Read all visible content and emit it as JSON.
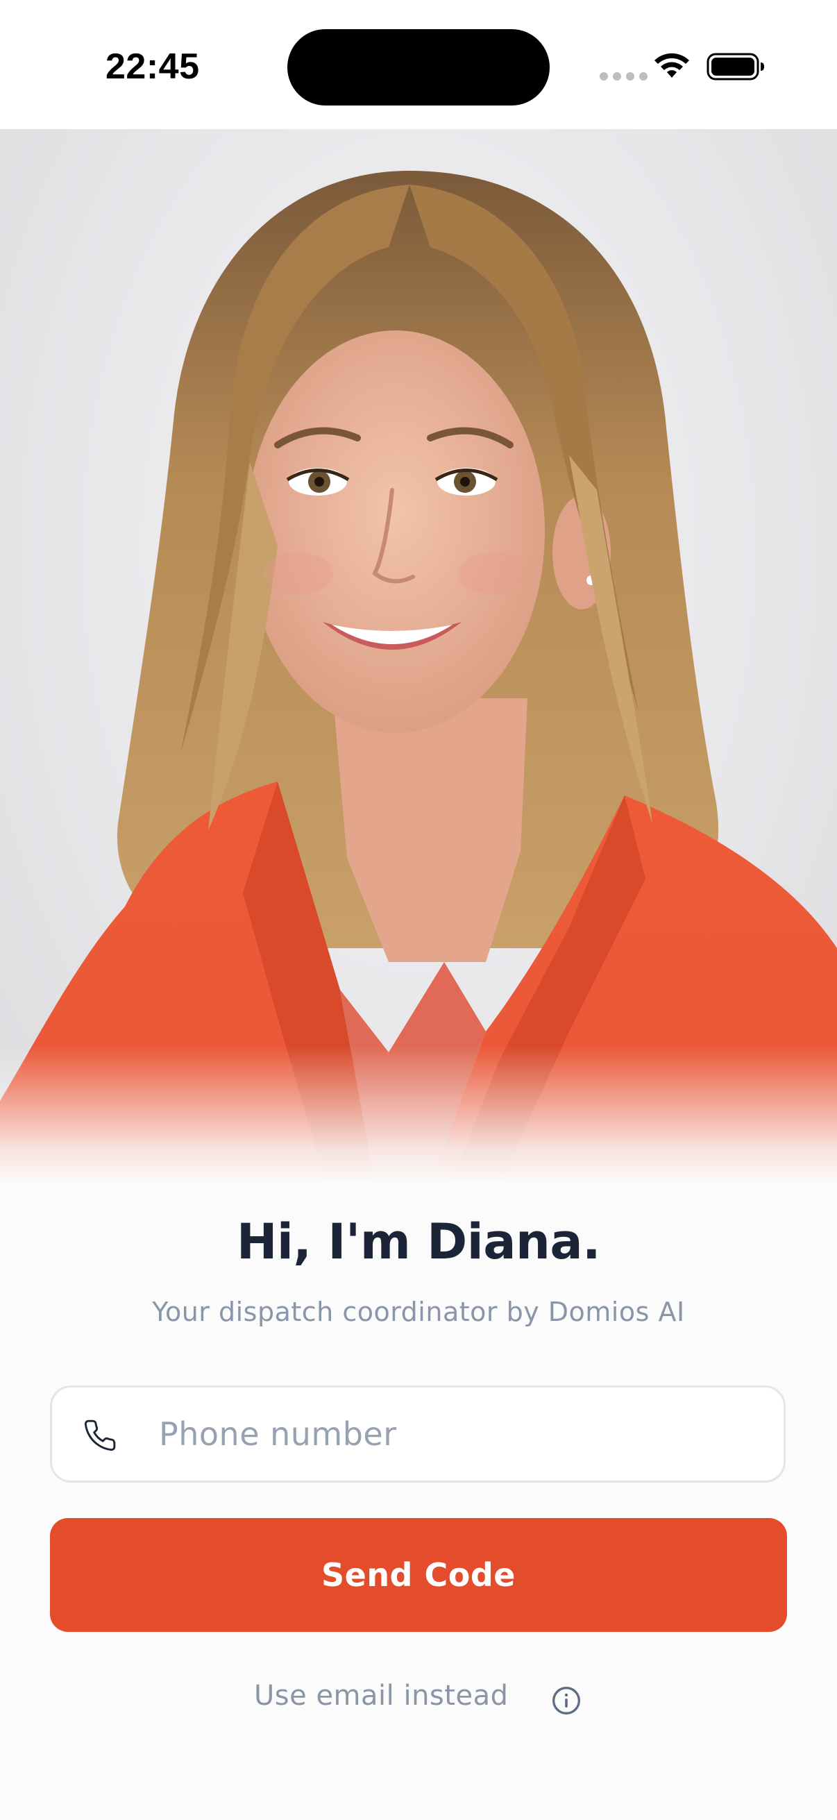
{
  "status_bar": {
    "time": "22:45",
    "icons": [
      "cellular-signal-icon",
      "wifi-icon",
      "battery-icon"
    ]
  },
  "hero": {
    "image": "portrait-photo",
    "jacket_color": "#ee5a36"
  },
  "greeting": {
    "title": "Hi, I'm Diana.",
    "subtitle": "Your dispatch coordinator by Domios AI"
  },
  "login": {
    "phone_icon": "phone-icon",
    "phone_placeholder": "Phone number",
    "phone_value": "",
    "send_label": "Send Code",
    "email_link": "Use email instead",
    "info_icon": "info-icon"
  },
  "colors": {
    "accent": "#e34d2b",
    "title": "#1c2538",
    "muted": "#8a95a8",
    "background": "#fbfbfb"
  }
}
